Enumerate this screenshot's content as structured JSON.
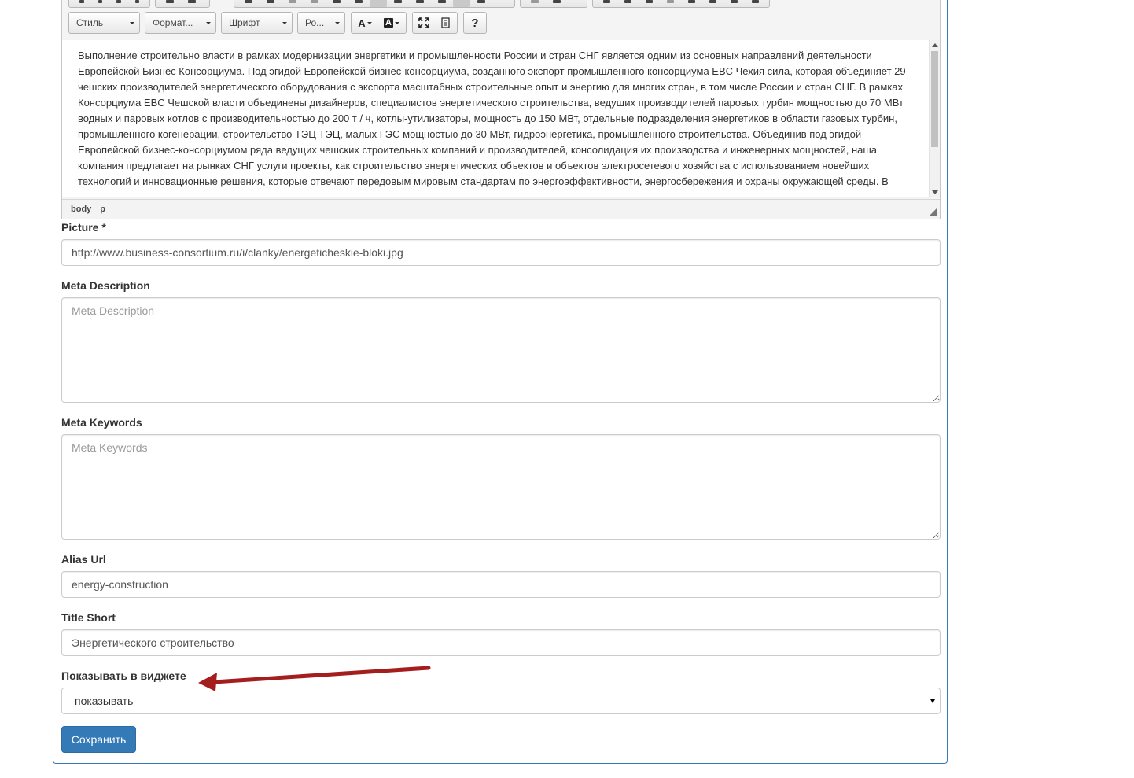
{
  "editor": {
    "style_combo": "Стиль",
    "format_combo": "Формат...",
    "font_combo": "Шрифт",
    "size_combo": "Ро...",
    "text_color_icon": "text-color-icon",
    "bg_color_icon": "bg-color-icon",
    "maximize_icon": "maximize-icon",
    "show_blocks_icon": "show-blocks-icon",
    "help_label": "?",
    "content": "Выполнение строительно власти в рамках модернизации энергетики и промышленности России и стран СНГ является одним из основных направлений деятельности Европейской Бизнес Консорциума. Под эгидой Европейской бизнес-консорциума, созданного экспорт промышленного консорциума EBC Чехия сила, которая объединяет 29 чешских производителей энергетического оборудования с экспорта масштабных строительные опыт и энергию для многих стран, в том числе России и стран СНГ. В рамках Консорциума EBC Чешской власти объединены дизайнеров, специалистов энергетического строительства, ведущих производителей паровых турбин мощностью до 70 МВт водных и паровых котлов с производительностью до 200 т / ч, котлы-утилизаторы, мощность до 150 МВт, отдельные подразделения энергетиков в области газовых турбин, промышленного когенерации, строительство ТЭЦ ТЭЦ, малых ГЭС мощностью до 30 МВт, гидроэнергетика, промышленного строительства. Объединив под эгидой Европейской бизнес-консорциумом ряда ведущих чешских строительных компаний и производителей, консолидация их производства и инженерных мощностей, наша компания предлагает на рынках СНГ услуги проекты, как строительство энергетических объектов и объектов электросетевого хозяйства с использованием новейших технологий и инновационные решения, которые отвечают передовым мировым стандартам по энергоэффективности, энергосбережения и охраны окружающей среды. В",
    "path": [
      "body",
      "p"
    ]
  },
  "form": {
    "picture": {
      "label": "Picture *",
      "value": "http://www.business-consortium.ru/i/clanky/energeticheskie-bloki.jpg"
    },
    "meta_description": {
      "label": "Meta Description",
      "placeholder": "Meta Description",
      "value": ""
    },
    "meta_keywords": {
      "label": "Meta Keywords",
      "placeholder": "Meta Keywords",
      "value": ""
    },
    "alias_url": {
      "label": "Alias Url",
      "value": "energy-construction"
    },
    "title_short": {
      "label": "Title Short",
      "value": "Энергетического строительство"
    },
    "show_in_widget": {
      "label": "Показывать в виджете",
      "selected": "показывать"
    },
    "save_label": "Сохранить"
  },
  "colors": {
    "primary": "#337ab7",
    "annotation_arrow": "#a51e1e"
  }
}
